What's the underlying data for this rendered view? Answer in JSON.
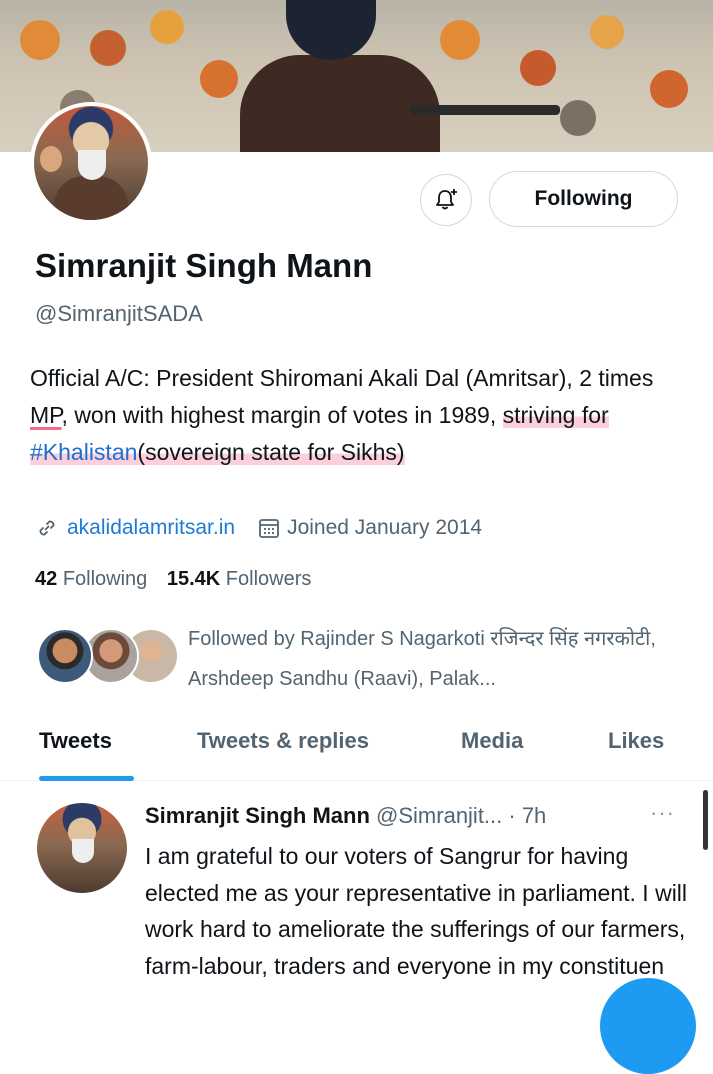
{
  "profile": {
    "name": "Simranjit Singh Mann",
    "handle": "@SimranjitSADA",
    "follow_button": "Following",
    "bio": {
      "part1": "Official A/C: President Shiromani Akali Dal (Amritsar), 2 times ",
      "mp": "MP",
      "part2": ", won with highest margin of votes in 1989, ",
      "striving": "striving for ",
      "hashtag": "#Khalistan",
      "tail": "(sovereign state for Sikhs)"
    },
    "website": "akalidalamritsar.in",
    "joined": "Joined January 2014",
    "following_count": "42",
    "following_label": "Following",
    "followers_count": "15.4K",
    "followers_label": "Followers",
    "followed_by": "Followed by Rajinder S Nagarkoti रजिन्दर सिंह नगरकोटी, Arshdeep Sandhu (Raavi), Palak..."
  },
  "tabs": [
    {
      "label": "Tweets"
    },
    {
      "label": "Tweets & replies"
    },
    {
      "label": "Media"
    },
    {
      "label": "Likes"
    }
  ],
  "tweet": {
    "name": "Simranjit Singh Mann",
    "handle_time": "@Simranjit... · 7h",
    "more": "···",
    "text": "I am grateful to our voters of Sangrur for having elected me as your representative in parliament. I will work hard to ameliorate the sufferings of our farmers, farm-labour, traders and everyone in my constituen"
  },
  "icons": {
    "bell": "notification-bell-plus-icon",
    "link": "link-icon",
    "calendar": "calendar-icon"
  },
  "colors": {
    "accent": "#1d9bf0",
    "link": "#1d7bd6",
    "muted": "#536471",
    "highlight": "#f26b8e"
  }
}
